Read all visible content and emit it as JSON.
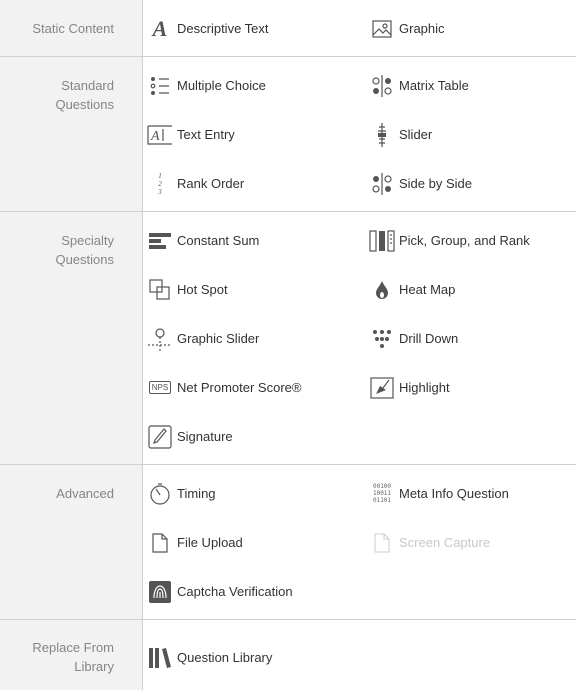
{
  "sections": [
    {
      "label": "Static Content",
      "items": [
        {
          "label": "Descriptive Text",
          "icon": "descriptive-text-icon"
        },
        {
          "label": "Graphic",
          "icon": "graphic-icon"
        }
      ]
    },
    {
      "label": "Standard Questions",
      "items": [
        {
          "label": "Multiple Choice",
          "icon": "multiple-choice-icon"
        },
        {
          "label": "Matrix Table",
          "icon": "matrix-table-icon"
        },
        {
          "label": "Text Entry",
          "icon": "text-entry-icon"
        },
        {
          "label": "Slider",
          "icon": "slider-icon"
        },
        {
          "label": "Rank Order",
          "icon": "rank-order-icon"
        },
        {
          "label": "Side by Side",
          "icon": "side-by-side-icon"
        }
      ]
    },
    {
      "label": "Specialty Questions",
      "items": [
        {
          "label": "Constant Sum",
          "icon": "constant-sum-icon"
        },
        {
          "label": "Pick, Group, and Rank",
          "icon": "pick-group-rank-icon"
        },
        {
          "label": "Hot Spot",
          "icon": "hot-spot-icon"
        },
        {
          "label": "Heat Map",
          "icon": "heat-map-icon"
        },
        {
          "label": "Graphic Slider",
          "icon": "graphic-slider-icon"
        },
        {
          "label": "Drill Down",
          "icon": "drill-down-icon"
        },
        {
          "label": "Net Promoter Score®",
          "icon": "nps-icon",
          "icon_text": "NPS"
        },
        {
          "label": "Highlight",
          "icon": "highlight-icon"
        },
        {
          "label": "Signature",
          "icon": "signature-icon"
        }
      ]
    },
    {
      "label": "Advanced",
      "items": [
        {
          "label": "Timing",
          "icon": "timing-icon"
        },
        {
          "label": "Meta Info Question",
          "icon": "meta-info-icon",
          "icon_text": "00100\n10011\n01101"
        },
        {
          "label": "File Upload",
          "icon": "file-upload-icon"
        },
        {
          "label": "Screen Capture",
          "icon": "screen-capture-icon",
          "disabled": true
        },
        {
          "label": "Captcha Verification",
          "icon": "captcha-icon"
        }
      ]
    },
    {
      "label": "Replace From Library",
      "items": [
        {
          "label": "Question Library",
          "icon": "question-library-icon"
        }
      ]
    }
  ]
}
